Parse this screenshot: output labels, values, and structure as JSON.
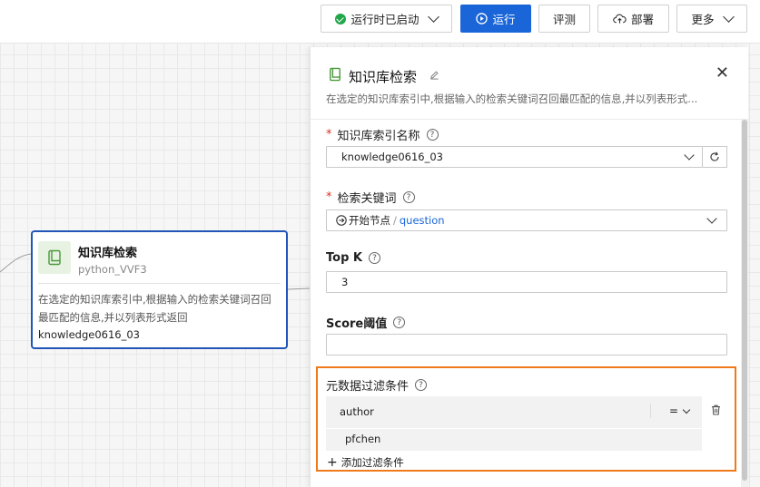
{
  "toolbar": {
    "status_label": "运行时已启动",
    "run_label": "运行",
    "evaluate_label": "评测",
    "deploy_label": "部署",
    "more_label": "更多"
  },
  "node": {
    "title": "知识库检索",
    "subtitle": "python_VVF3",
    "description_line1": "在选定的知识库索引中,根据输入的检索关键词召回",
    "description_line2": "最匹配的信息,并以列表形式返回",
    "knowledge_base": "knowledge0616_03"
  },
  "panel": {
    "title": "知识库检索",
    "description": "在选定的知识库索引中,根据输入的检索关键词召回最匹配的信息,并以列表形式...",
    "close_glyph": "✕",
    "index_label": "知识库索引名称",
    "index_value": "knowledge0616_03",
    "keyword_label": "检索关键词",
    "keyword_source": "开始节点",
    "keyword_separator": "/",
    "keyword_field": "question",
    "topk_label": "Top K",
    "topk_value": "3",
    "score_label": "Score阈值",
    "score_value": "",
    "meta_label": "元数据过滤条件",
    "meta_key": "author",
    "meta_operator": "=",
    "meta_value": "pfchen",
    "add_filter_label": "添加过滤条件",
    "add_glyph": "+",
    "required_mark": "*",
    "help_glyph": "?"
  },
  "colors": {
    "primary": "#1a66d9",
    "highlight_border": "#ef7a1a",
    "node_border": "#2255b8",
    "required": "#d93026",
    "running": "#21a64a"
  }
}
